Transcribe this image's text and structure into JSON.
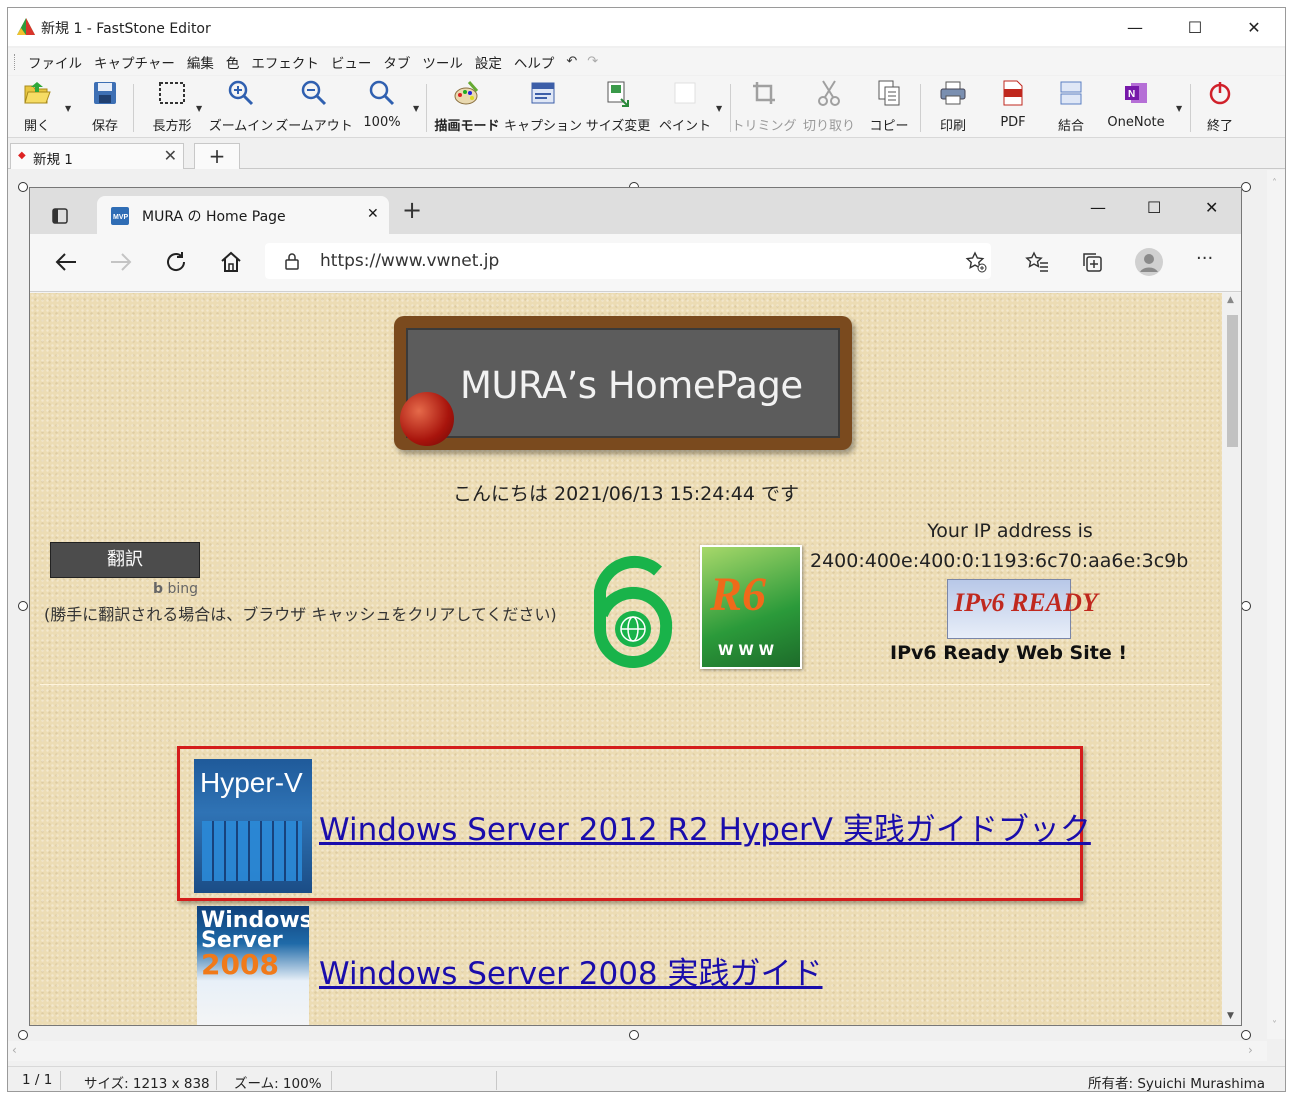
{
  "window": {
    "title": "新規 1 - FastStone Editor",
    "controls": {
      "minimize": "—",
      "maximize": "☐",
      "close": "✕"
    }
  },
  "menu": {
    "items": [
      "ファイル",
      "キャプチャー",
      "編集",
      "色",
      "エフェクト",
      "ビュー",
      "タブ",
      "ツール",
      "設定",
      "ヘルプ"
    ],
    "undo_icon": "undo-icon",
    "redo_icon": "redo-icon"
  },
  "toolbar": {
    "open": "開く",
    "save": "保存",
    "rectangle": "長方形",
    "zoom_in": "ズームイン",
    "zoom_out": "ズームアウト",
    "zoom_level": "100%",
    "draw_mode": "描画モード",
    "caption": "キャプション",
    "resize": "サイズ変更",
    "paint": "ペイント",
    "trim": "トリミング",
    "cut": "切り取り",
    "copy": "コピー",
    "print": "印刷",
    "pdf": "PDF",
    "combine": "結合",
    "onenote": "OneNote",
    "exit": "終了"
  },
  "doc_tabs": {
    "active_label": "新規 1",
    "close": "✕",
    "add": "+"
  },
  "captured": {
    "browser": {
      "tab_title": "MURA の Home Page",
      "tab_close": "✕",
      "new_tab": "+",
      "url": "https://www.vwnet.jp",
      "more": "···"
    },
    "page": {
      "banner_title": "MURA’s HomePage",
      "greeting": "こんにちは 2021/06/13 15:24:44 です",
      "translate_button": "翻訳",
      "bing": "bing",
      "note": "(勝手に翻訳される場合は、ブラウザ キャッシュをクリアしてください)",
      "ip_label": "Your IP address is",
      "ip_value": "2400:400e:400:0:1193:6c70:aa6e:3c9b",
      "ipv6_ready": "IPv6 Ready Web Site !",
      "ipv6_badge_text": "IPv6 READY",
      "r6_badge_text": "R6",
      "book1_cover_text": "Hyper-V",
      "book2_cover_text_1": "Windows",
      "book2_cover_text_2": "Server",
      "book2_cover_text_3": "2008",
      "book1_link": "Windows Server 2012 R2 HyperV 実践ガイドブック",
      "book2_link": "Windows Server 2008 実践ガイド"
    }
  },
  "status": {
    "page": "1 / 1",
    "size": "サイズ: 1213 x 838",
    "zoom": "ズーム: 100%",
    "owner": "所有者: Syuichi Murashima"
  },
  "colors": {
    "selection_box": "#d41c1c",
    "link": "#1a0dab",
    "page_background": "#ecdcb4"
  }
}
